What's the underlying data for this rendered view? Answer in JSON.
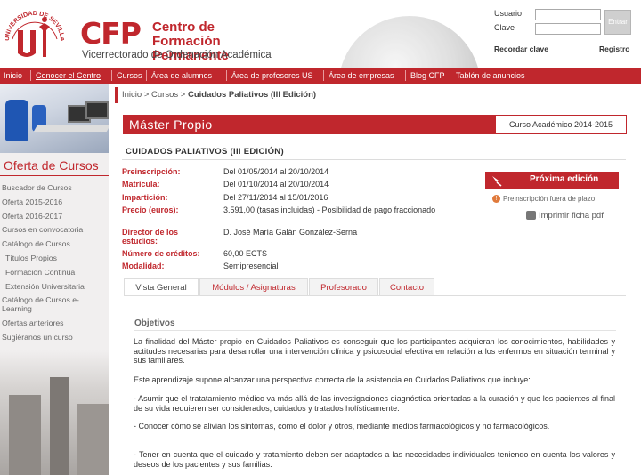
{
  "header": {
    "logo_name": "UNIVERSIDAD DE SEVILLA",
    "cfp": "CFP",
    "title_line1": "Centro de Formación",
    "title_line2": "Permanente",
    "subtitle": "Vicerrectorado de Ordenación Académica",
    "brand_color": "#c0272d"
  },
  "login": {
    "user_label": "Usuario",
    "pass_label": "Clave",
    "submit": "Entrar",
    "remember": "Recordar clave",
    "register": "Registro"
  },
  "nav": [
    "Inicio",
    "Conocer el Centro",
    "Cursos",
    "Área de alumnos",
    "Área de profesores US",
    "Área de empresas",
    "Blog CFP",
    "Tablón de anuncios"
  ],
  "sidebar": {
    "heading": "Oferta de Cursos",
    "items": [
      "Buscador de Cursos",
      "Oferta 2015-2016",
      "Oferta 2016-2017",
      "Cursos en convocatoria",
      "Catálogo de Cursos",
      "Títulos Propios",
      "Formación Continua",
      "Extensión Universitaria",
      "Catálogo de Cursos e-",
      "Learning",
      "Ofertas anteriores",
      "Sugiéranos un curso"
    ]
  },
  "breadcrumb": {
    "home": "Inicio",
    "sep1": ">",
    "section": "Cursos",
    "sep2": ">",
    "current": "Cuidados Paliativos (III Edición)"
  },
  "course": {
    "type": "Máster Propio",
    "academic_year": "Curso Académico 2014-2015",
    "title": "CUIDADOS PALIATIVOS (III EDICIÓN)",
    "fields": [
      {
        "label": "Preinscripción:",
        "value": "Del 01/05/2014 al 20/10/2014"
      },
      {
        "label": "Matrícula:",
        "value": "Del 01/10/2014 al 20/10/2014"
      },
      {
        "label": "Impartición:",
        "value": "Del 27/11/2014 al 15/01/2016"
      },
      {
        "label": "Precio (euros):",
        "value": "3.591,00 (tasas incluidas) - Posibilidad de pago fraccionado"
      },
      {
        "label": "Director de los estudios:",
        "value": "D. José María Galán González-Serna"
      },
      {
        "label": "Número de créditos:",
        "value": "60,00 ECTS"
      },
      {
        "label": "Modalidad:",
        "value": "Semipresencial"
      }
    ],
    "next_edition": "Próxima edición",
    "prereg_note": "Preinscripción fuera de plazo",
    "print": "Imprimir ficha pdf"
  },
  "tabs": [
    "Vista General",
    "Módulos / Asignaturas",
    "Profesorado",
    "Contacto"
  ],
  "content": {
    "heading": "Objetivos",
    "paragraphs": [
      "La finalidad del Máster propio en Cuidados Paliativos es conseguir que los participantes adquieran los conocimientos, habilidades y actitudes necesarias para desarrollar una intervención clínica y psicosocial efectiva en relación a los enfermos en situación terminal y sus familiares.",
      "Este aprendizaje supone alcanzar una perspectiva correcta de la asistencia en Cuidados Paliativos que incluye:",
      "- Asumir que el tratatamiento médico va más allá de las investigaciones diagnóstica orientadas a la curación y que los pacientes al final de su vida requieren ser considerados, cuidados y tratados holísticamente.",
      "- Conocer cómo se alivian los síntomas, como el dolor y otros, mediante medios farmacológicos y no farmacológicos.",
      "- Tener en cuenta que el cuidado y tratamiento deben ser adaptados a las necesidades individuales teniendo en cuenta los valores y deseos de los pacientes y sus familias."
    ]
  }
}
